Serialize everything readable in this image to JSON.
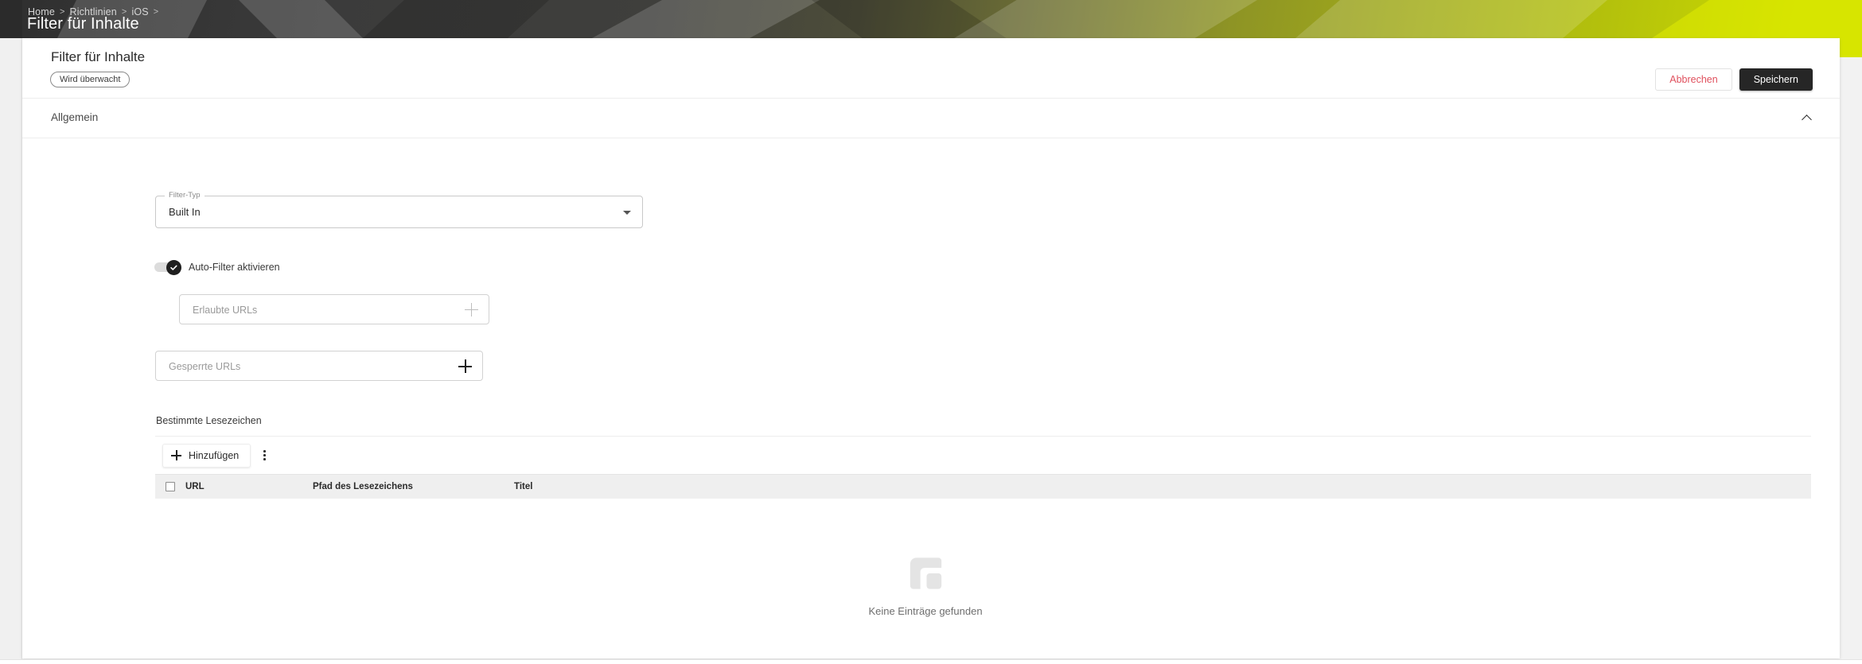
{
  "banner": {
    "breadcrumb": [
      {
        "label": "Home",
        "sep": ">"
      },
      {
        "label": "Richtlinien",
        "sep": ">"
      },
      {
        "label": "iOS",
        "sep": ">"
      }
    ],
    "title": "Filter für Inhalte",
    "gradient_from": "#2f2f2f",
    "gradient_to": "#c9d900"
  },
  "card": {
    "title": "Filter für Inhalte",
    "status_badge": "Wird überwacht",
    "cancel_label": "Abbrechen",
    "save_label": "Speichern",
    "cancel_color": "#e0505d",
    "save_bg": "#262626"
  },
  "section": {
    "title": "Allgemein",
    "collapse_icon": "chevron-up-icon"
  },
  "form": {
    "filter_type": {
      "label": "Filter-Typ",
      "value": "Built In",
      "caret_icon": "chevron-down-icon"
    },
    "auto_filter": {
      "label": "Auto-Filter aktivieren",
      "checked": true,
      "knob_icon": "check-icon"
    },
    "allowed_urls": {
      "placeholder": "Erlaubte URLs",
      "value": "",
      "add_icon": "plus-icon"
    },
    "blocked_urls": {
      "placeholder": "Gesperrte URLs",
      "value": "",
      "add_icon": "plus-icon"
    },
    "bookmarks_label": "Bestimmte Lesezeichen"
  },
  "table": {
    "add_label": "Hinzufügen",
    "add_icon": "plus-icon",
    "menu_icon": "kebab-menu-icon",
    "columns": {
      "select_all": "",
      "url": "URL",
      "path": "Pfad des Lesezeichens",
      "title": "Titel"
    },
    "rows": [],
    "empty_text": "Keine Einträge gefunden",
    "empty_icon": "brand-logo-icon"
  }
}
